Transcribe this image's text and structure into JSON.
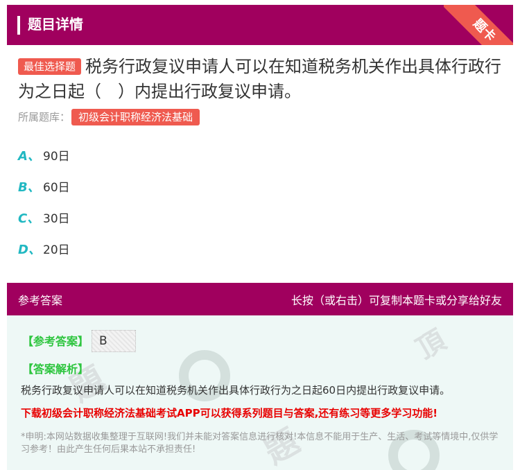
{
  "header": {
    "title": "题目详情",
    "corner_badge": "题卡"
  },
  "question": {
    "type_badge": "最佳选择题",
    "text": "税务行政复议申请人可以在知道税务机关作出具体行政行为之日起（　）内提出行政复议申请。",
    "source_label": "所属题库：",
    "source_name": "初级会计职称经济法基础"
  },
  "options": [
    {
      "letter": "A、",
      "text": "90日"
    },
    {
      "letter": "B、",
      "text": "60日"
    },
    {
      "letter": "C、",
      "text": "30日"
    },
    {
      "letter": "D、",
      "text": "20日"
    }
  ],
  "answer_section": {
    "header_left": "参考答案",
    "header_right": "长按（或右击）可复制本题卡或分享给好友",
    "ref_label": "【参考答案】",
    "ref_value": "B",
    "analysis_label": "【答案解析】",
    "analysis_text": "税务行政复议申请人可以在知道税务机关作出具体行政行为之日起60日内提出行政复议申请。",
    "promo_text": "下载初级会计职称经济法基础考试APP可以获得系列题目与答案,还有练习等更多学习功能!",
    "disclaimer": "*申明:本网站数据收集整理于互联网!我们并未能对答案信息进行核对!本信息不能用于生产、生活、考试等情境中,仅供学习参考！由此产生任何后果本站不承担责任!"
  },
  "colors": {
    "brand": "#a0005e",
    "accent_red": "#ef5a4f",
    "option_letter": "#21b8c2",
    "answer_green": "#2ec53f",
    "answer_bg": "#eef8f6"
  }
}
